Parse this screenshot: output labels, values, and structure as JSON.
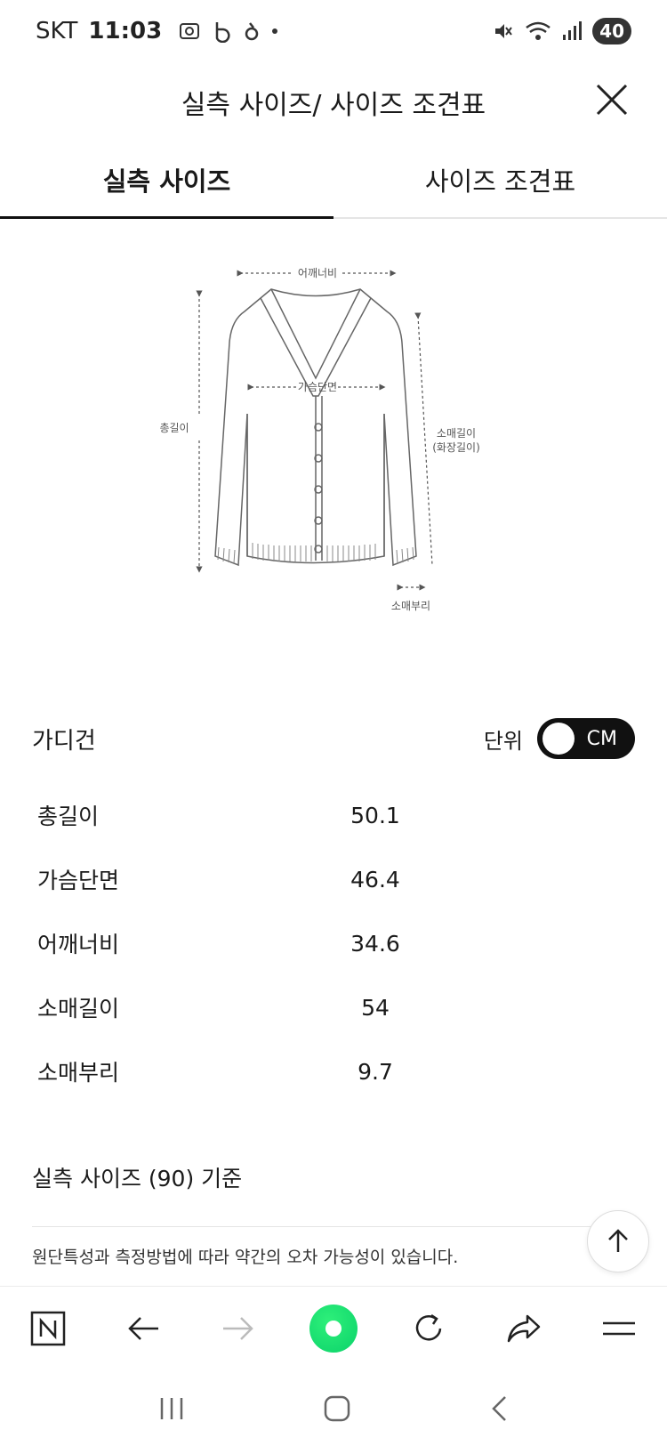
{
  "status": {
    "carrier": "SKT",
    "time": "11:03",
    "battery": "40"
  },
  "header": {
    "title": "실측 사이즈/ 사이즈 조견표"
  },
  "tabs": [
    {
      "label": "실측 사이즈",
      "active": true
    },
    {
      "label": "사이즈 조견표",
      "active": false
    }
  ],
  "diagram": {
    "shoulder": "어깨너비",
    "chest": "가슴단면",
    "length": "총길이",
    "sleeve": "소매길이",
    "sleeve_sub": "(화장길이)",
    "cuff": "소매부리"
  },
  "product": {
    "name": "가디건",
    "unit_label": "단위",
    "unit_value": "CM"
  },
  "sizes": [
    {
      "label": "총길이",
      "value": "50.1"
    },
    {
      "label": "가슴단면",
      "value": "46.4"
    },
    {
      "label": "어깨너비",
      "value": "34.6"
    },
    {
      "label": "소매길이",
      "value": "54"
    },
    {
      "label": "소매부리",
      "value": "9.7"
    }
  ],
  "basis": "실측 사이즈 (90) 기준",
  "notice": "원단특성과 측정방법에 따라 약간의 오차 가능성이 있습니다.",
  "icons": {
    "close": "close-icon",
    "scroll_top": "arrow-up-icon",
    "n_logo": "n-logo-icon",
    "back": "arrow-left-icon",
    "forward": "arrow-right-icon",
    "home": "green-circle-icon",
    "refresh": "refresh-icon",
    "share": "share-icon",
    "menu": "menu-icon"
  },
  "colors": {
    "accent_green": "#0bd26a",
    "text": "#1a1a1a",
    "toggle_bg": "#111111"
  }
}
